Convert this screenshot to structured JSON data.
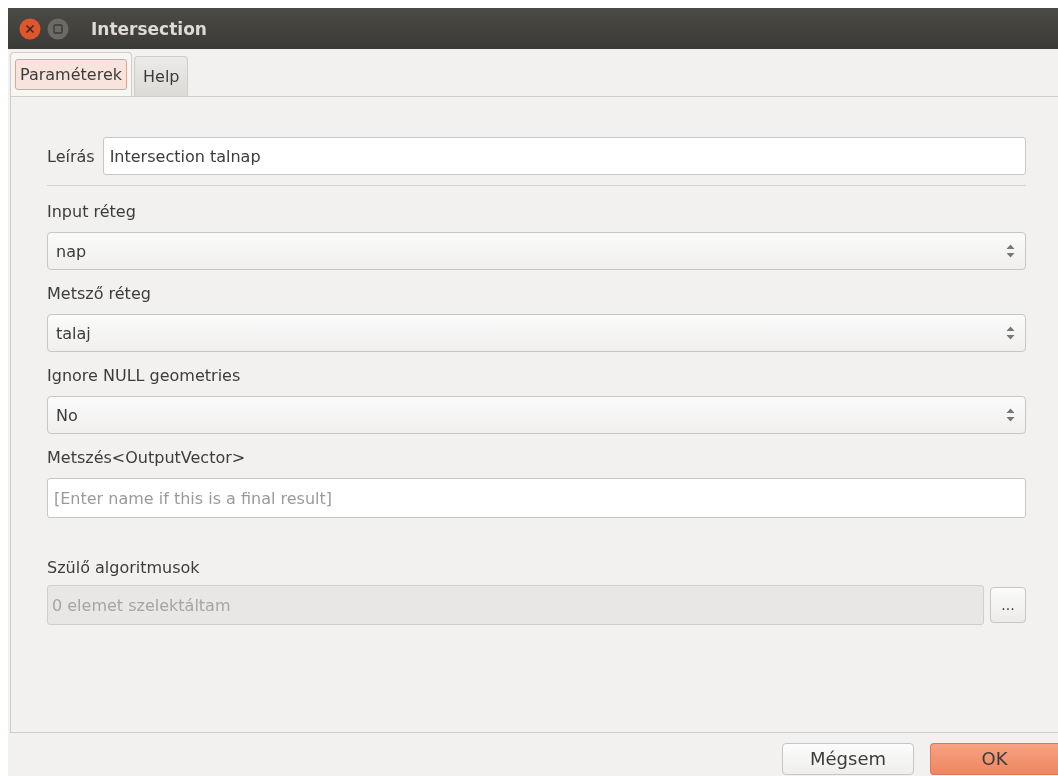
{
  "window": {
    "title": "Intersection"
  },
  "tabs": [
    {
      "label": "Paraméterek",
      "selected": true
    },
    {
      "label": "Help",
      "selected": false
    }
  ],
  "description": {
    "label": "Leírás",
    "value": "Intersection talnap"
  },
  "parameters": [
    {
      "kind": "combo",
      "label": "Input réteg",
      "value": "nap"
    },
    {
      "kind": "combo",
      "label": "Metsző réteg",
      "value": "talaj"
    },
    {
      "kind": "combo",
      "label": "Ignore NULL geometries",
      "value": "No"
    },
    {
      "kind": "text",
      "label": "Metszés<OutputVector>",
      "placeholder": "[Enter name if this is a final result]"
    }
  ],
  "parent_algorithms": {
    "label": "Szülő algoritmusok",
    "value": "0 elemet szelektáltam",
    "disabled": true,
    "button": "..."
  },
  "buttons": [
    {
      "label": "Mégsem",
      "kind": "default"
    },
    {
      "label": "OK",
      "kind": "primary"
    }
  ]
}
